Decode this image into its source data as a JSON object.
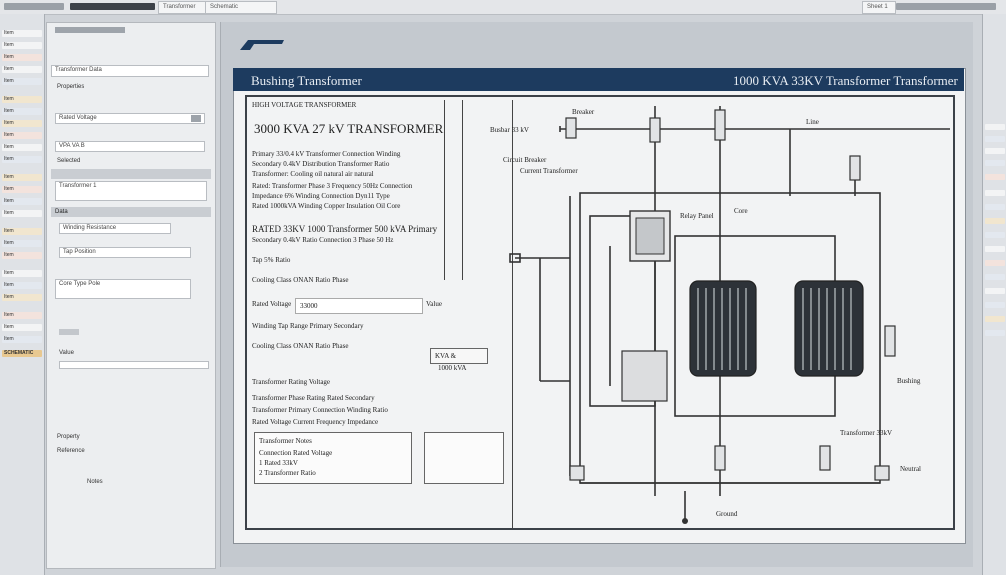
{
  "window": {
    "tabs": [
      "Transformer",
      "Schematic",
      "Sheet 1"
    ]
  },
  "left_strip": {
    "items": [
      "Item",
      "Item",
      "Item",
      "Item",
      "Item",
      "Item",
      "Item",
      "Item",
      "Item",
      "Item",
      "Item",
      "Item",
      "Item",
      "Item",
      "Item",
      "Item",
      "Item",
      "Item",
      "Item",
      "Item",
      "Item",
      "Item",
      "Item",
      "Item"
    ],
    "active_label": "SCHEMATIC"
  },
  "side_panel": {
    "title": "Transformer Data",
    "section_label": "Properties",
    "field1_value": "Rated Voltage",
    "field2_value": "VPA   VA   B",
    "section2_label": "Selected",
    "field3_value": "Transformer 1",
    "section3_label": "Data",
    "field4_value": "Winding Resistance",
    "field5_value": "Tap Position",
    "field6_value": "Core Type Pole",
    "footer1": "Value",
    "footer2": "Property",
    "footer3": "Reference",
    "footer4": "Notes"
  },
  "sheet": {
    "header_left": "Bushing Transformer",
    "header_right": "1000 KVA 33KV  Transformer Transformer",
    "spec_title": "3000 KVA  27 kV    TRANSFORMER",
    "subtitle": "HIGH VOLTAGE TRANSFORMER",
    "para1": [
      "Primary 33/0.4 kV Transformer Connection Winding",
      "Secondary 0.4kV Distribution Transformer Ratio",
      "Transformer: Cooling  oil natural air natural"
    ],
    "para2": [
      "Rated: Transformer Phase 3 Frequency 50Hz Connection",
      "Impedance 6% Winding Connection Dyn11 Type",
      "Rated 1000kVA  Winding Copper  Insulation Oil Core"
    ],
    "para3": [
      "RATED 33KV 1000 Transformer 500 kVA Primary",
      "Secondary 0.4kV Ratio Connection 3 Phase 50 Hz",
      "Tap 5% Ratio"
    ],
    "field_label": "Rated Voltage",
    "field_value": "33000",
    "side_label": "Value",
    "row_a": "Winding Tap    Range  Primary    Secondary",
    "row_b": "Cooling Class  ONAN   Ratio   Phase",
    "box_label": "KVA &",
    "box_sub": "1000 kVA",
    "table_title": "Transformer Rating  Voltage",
    "table_rows": [
      "Transformer  Phase  Rating  Rated  Secondary",
      "Transformer  Primary  Connection  Winding  Ratio",
      "Rated  Voltage  Current  Frequency  Impedance"
    ],
    "note_title": "Transformer Notes",
    "note_lines": [
      "Connection Rated Voltage",
      "1  Rated 33kV",
      "2  Transformer Ratio"
    ],
    "diagram_labels": {
      "top": "Breaker",
      "top2": "Line",
      "bus": "Busbar 33 kV",
      "left_lbl": "Circuit Breaker",
      "mid_lbl": "Current Transformer",
      "ct_lbl": "Relay Panel",
      "core_lbl": "Core",
      "right_lbl": "Bushing",
      "bottom_lbl": "Ground",
      "br_lbl": "Transformer 33kV",
      "r_lbl": "Neutral"
    }
  },
  "colors": {
    "title_bar": "#1d3b5f",
    "sheet": "#f2f3f4",
    "frame": "#3c4148"
  }
}
